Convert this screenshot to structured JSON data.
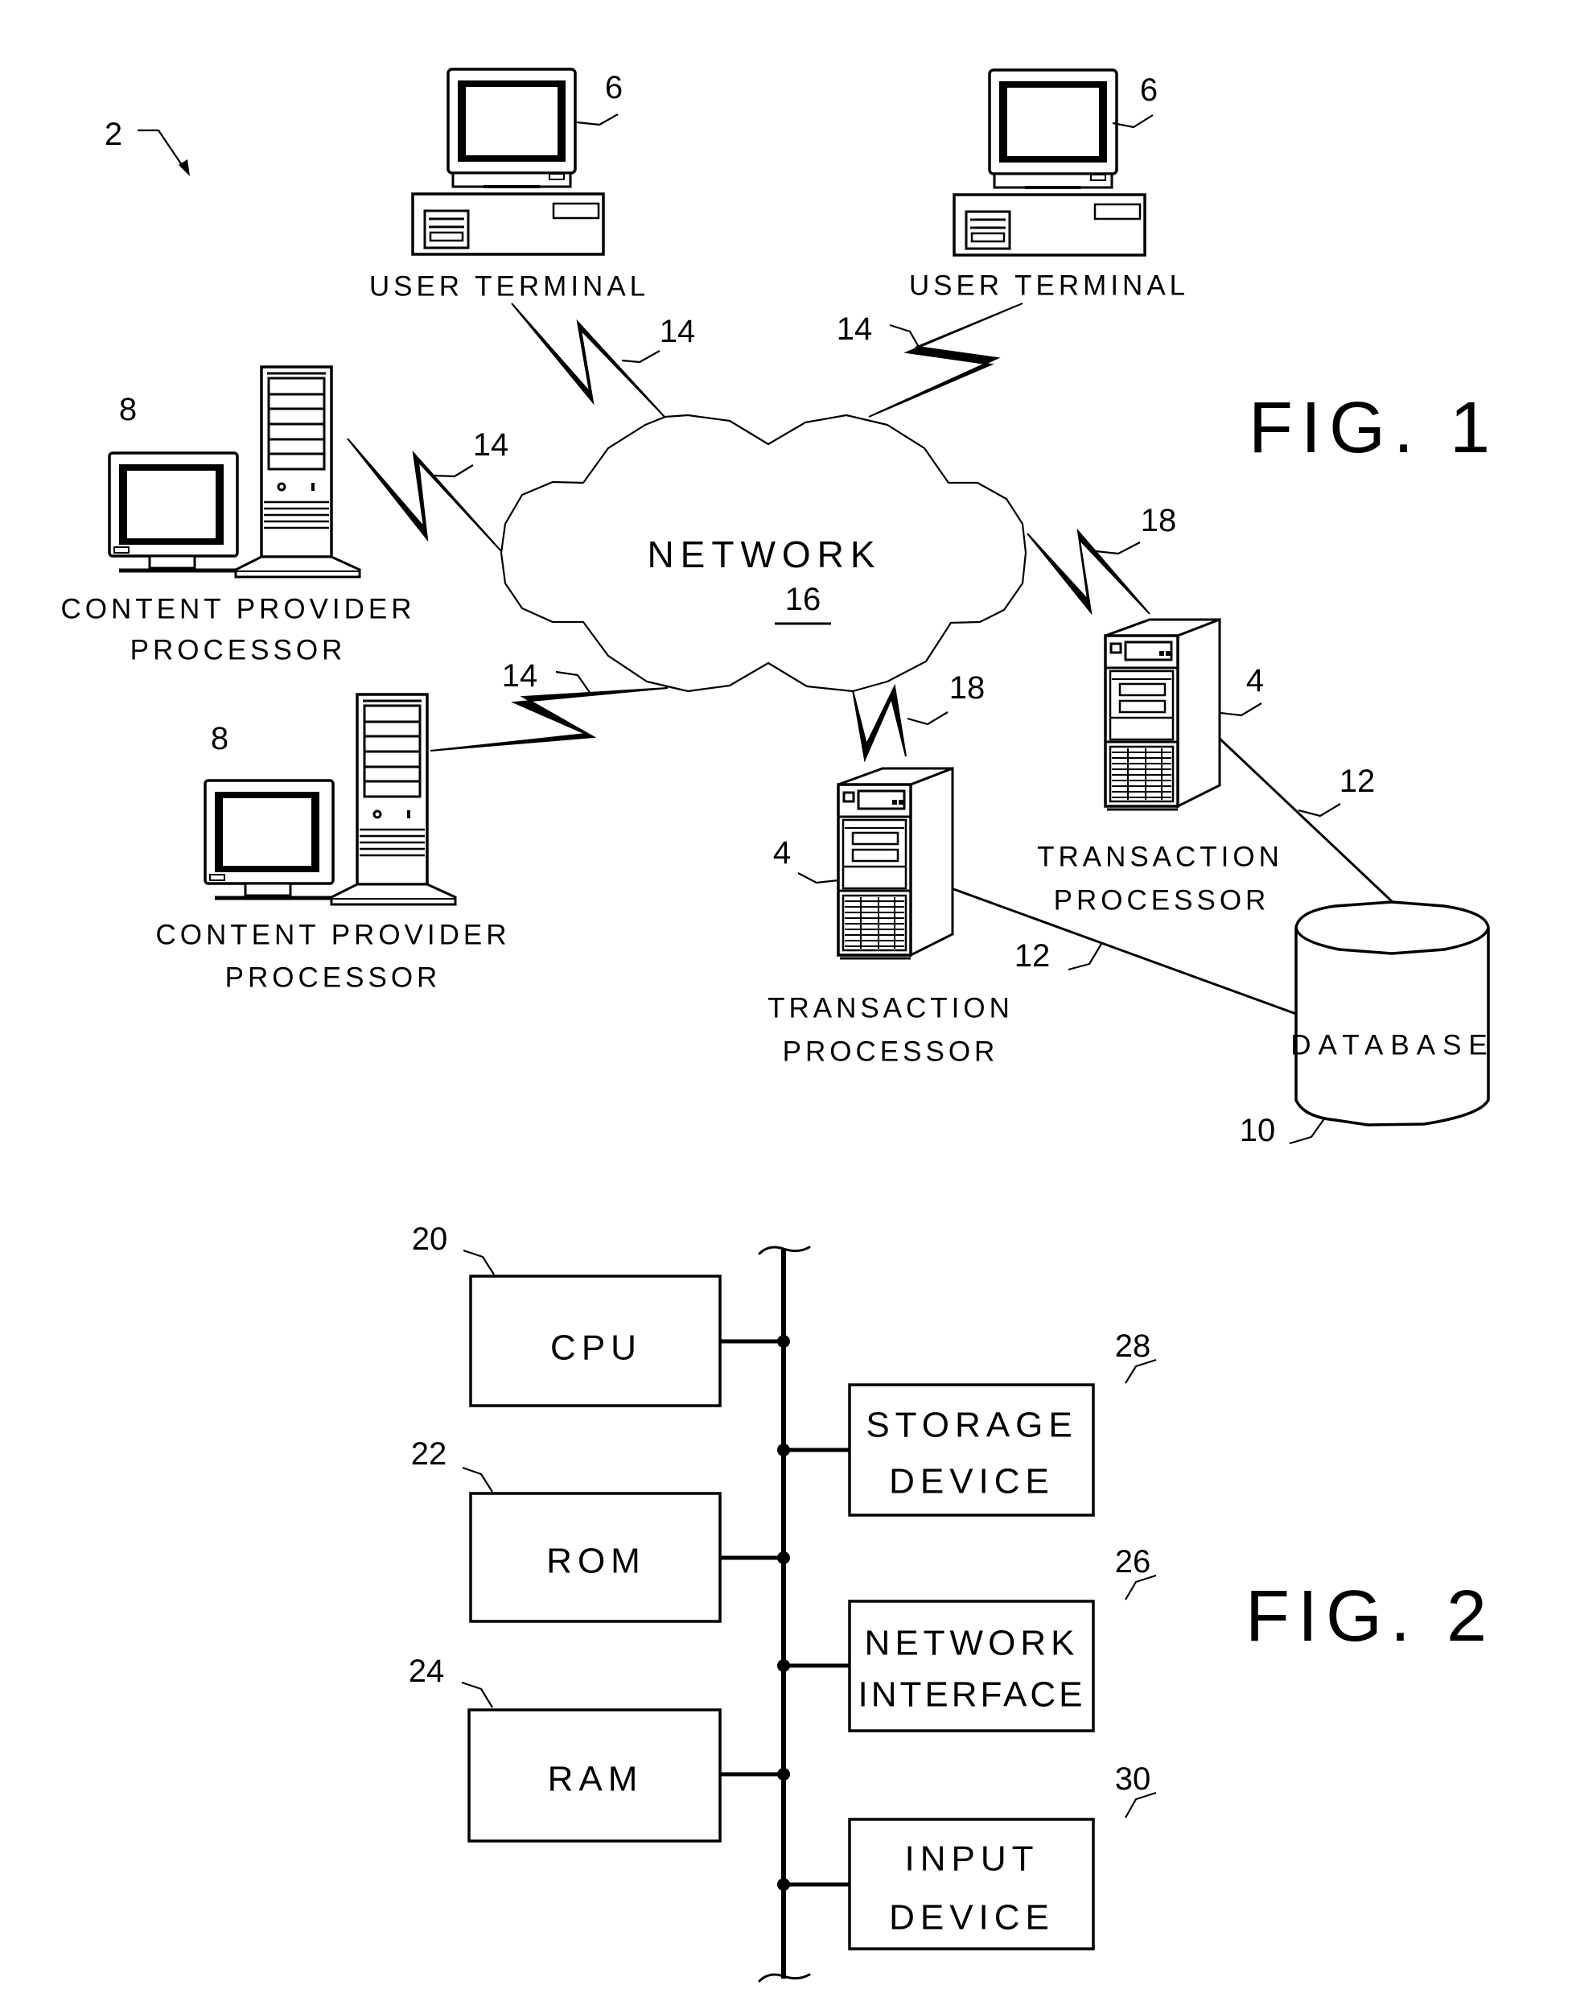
{
  "figure1": {
    "title": "FIG. 1",
    "system_ref": "2",
    "network": {
      "label": "NETWORK",
      "ref": "16"
    },
    "user_terminals": [
      {
        "label": "USER TERMINAL",
        "ref": "6",
        "link_ref": "14"
      },
      {
        "label": "USER TERMINAL",
        "ref": "6",
        "link_ref": "14"
      }
    ],
    "content_providers": [
      {
        "label_line1": "CONTENT PROVIDER",
        "label_line2": "PROCESSOR",
        "ref": "8",
        "link_ref": "14"
      },
      {
        "label_line1": "CONTENT PROVIDER",
        "label_line2": "PROCESSOR",
        "ref": "8",
        "link_ref": "14"
      }
    ],
    "transaction_processors": [
      {
        "label_line1": "TRANSACTION",
        "label_line2": "PROCESSOR",
        "ref": "4",
        "link_ref": "18",
        "db_link_ref": "12"
      },
      {
        "label_line1": "TRANSACTION",
        "label_line2": "PROCESSOR",
        "ref": "4",
        "link_ref": "18",
        "db_link_ref": "12"
      }
    ],
    "database": {
      "label": "DATABASE",
      "ref": "10"
    }
  },
  "figure2": {
    "title": "FIG. 2",
    "left_blocks": [
      {
        "label": "CPU",
        "ref": "20"
      },
      {
        "label": "ROM",
        "ref": "22"
      },
      {
        "label": "RAM",
        "ref": "24"
      }
    ],
    "right_blocks": [
      {
        "line1": "STORAGE",
        "line2": "DEVICE",
        "ref": "28"
      },
      {
        "line1": "NETWORK",
        "line2": "INTERFACE",
        "ref": "26"
      },
      {
        "line1": "INPUT",
        "line2": "DEVICE",
        "ref": "30"
      }
    ]
  }
}
